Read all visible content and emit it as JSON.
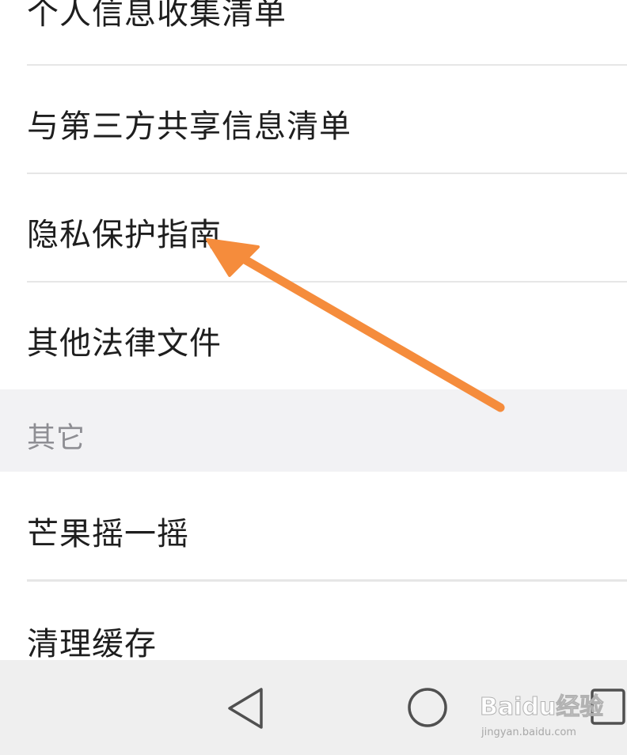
{
  "menu": {
    "items": [
      {
        "label": "个人信息收集清单"
      },
      {
        "label": "与第三方共享信息清单"
      },
      {
        "label": "隐私保护指南"
      },
      {
        "label": "其他法律文件"
      }
    ]
  },
  "other_section": {
    "header": "其它",
    "items": [
      {
        "label": "芒果摇一摇"
      },
      {
        "label": "清理缓存"
      }
    ]
  },
  "nav_bar": {
    "buttons": [
      "back-icon",
      "home-icon",
      "recents-icon"
    ]
  },
  "watermark": {
    "main": "Baidu经验",
    "sub": "jingyan.baidu.com"
  },
  "annotation": {
    "arrow_color": "#f58c3c"
  }
}
